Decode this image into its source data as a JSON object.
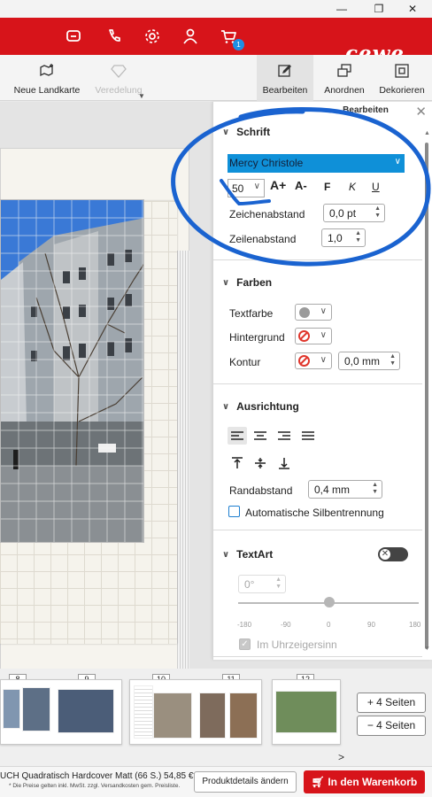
{
  "window": {
    "minimize": "—",
    "restore": "❐",
    "close": "✕"
  },
  "topnav": {
    "icons": [
      "chat-icon",
      "phone-icon",
      "settings-icon",
      "user-icon",
      "cart-icon"
    ],
    "cart_badge": "1",
    "logo": "cewe",
    "brand_color": "#d7141a"
  },
  "toolbar": {
    "new_map": "Neue Landkarte",
    "finishing": "Veredelung",
    "edit": "Bearbeiten",
    "arrange": "Anordnen",
    "decorate": "Dekorieren"
  },
  "panel": {
    "title": "Bearbeiten",
    "close": "✕",
    "font": {
      "heading": "Schrift",
      "family": "Mercy Christole",
      "size": "50",
      "grow": "A+",
      "shrink": "A-",
      "bold": "F",
      "italic": "K",
      "underline": "U",
      "letter_spacing_label": "Zeichenabstand",
      "letter_spacing_value": "0,0 pt",
      "line_spacing_label": "Zeilenabstand",
      "line_spacing_value": "1,0"
    },
    "colors": {
      "heading": "Farben",
      "text_color_label": "Textfarbe",
      "text_color": "#9a9a9a",
      "background_label": "Hintergrund",
      "outline_label": "Kontur",
      "outline_width": "0,0 mm"
    },
    "alignment": {
      "heading": "Ausrichtung",
      "padding_label": "Randabstand",
      "padding_value": "0,4 mm",
      "hyphenation_label": "Automatische Silbentrennung"
    },
    "textart": {
      "heading": "TextArt",
      "rotation_value": "0°",
      "ticks": [
        "-180",
        "-90",
        "0",
        "90",
        "180"
      ],
      "clockwise_label": "Im Uhrzeigersinn"
    }
  },
  "strip": {
    "page_numbers": [
      "8",
      "9",
      "10",
      "11",
      "12"
    ],
    "add_pages": "+ 4 Seiten",
    "remove_pages": "− 4 Seiten",
    "next": ">"
  },
  "footer": {
    "product": "UCH Quadratisch Hardcover Matt (66 S.) 54,85 €*",
    "note": "* Die Preise gelten inkl. MwSt. zzgl. Versandkosten gem. Preisliste.",
    "details_button": "Produktdetails ändern",
    "cart_button": "In den Warenkorb"
  }
}
